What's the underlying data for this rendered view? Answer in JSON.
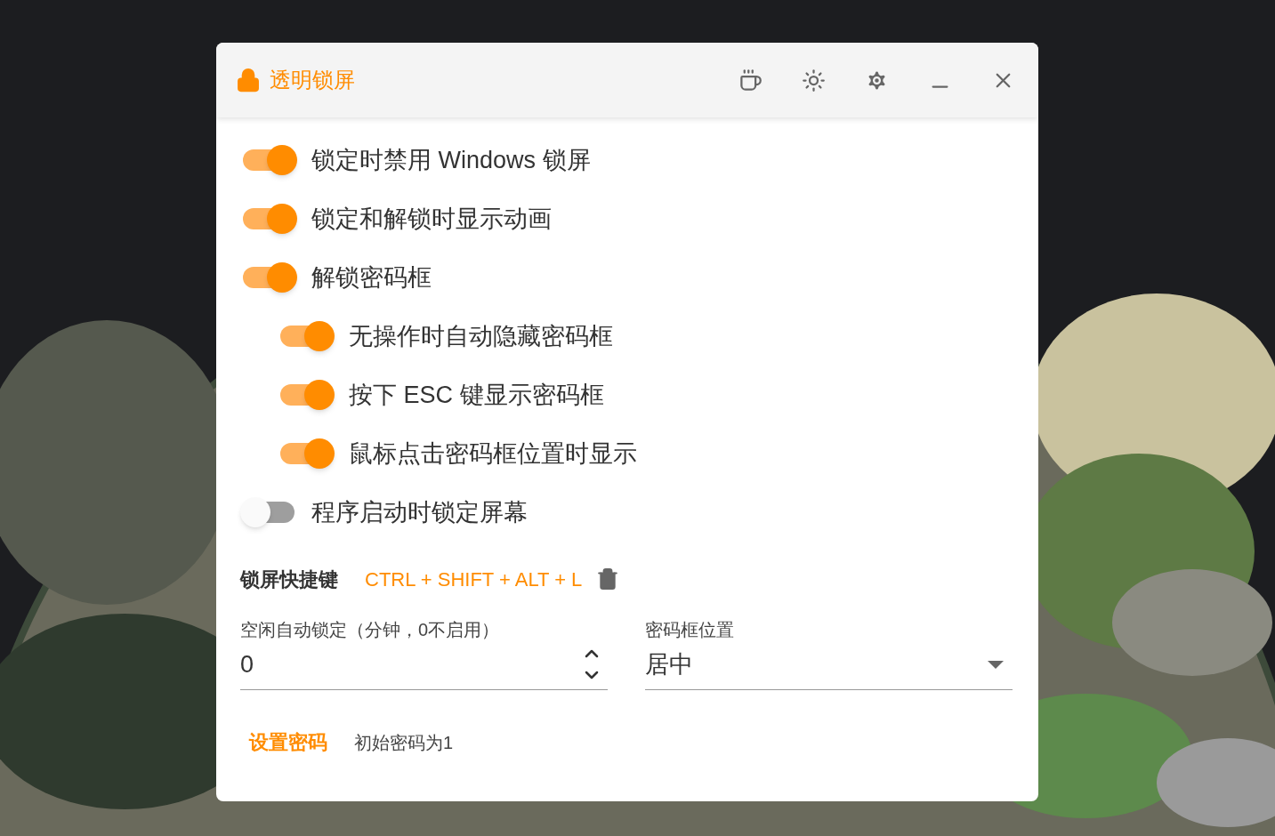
{
  "window": {
    "title": "透明锁屏"
  },
  "options": [
    {
      "label": "锁定时禁用 Windows 锁屏",
      "on": true
    },
    {
      "label": "锁定和解锁时显示动画",
      "on": true
    },
    {
      "label": "解锁密码框",
      "on": true,
      "children": [
        {
          "label": "无操作时自动隐藏密码框",
          "on": true
        },
        {
          "label": "按下 ESC 键显示密码框",
          "on": true
        },
        {
          "label": "鼠标点击密码框位置时显示",
          "on": true
        }
      ]
    },
    {
      "label": "程序启动时锁定屏幕",
      "on": false
    }
  ],
  "hotkey": {
    "label": "锁屏快捷键",
    "value": "CTRL + SHIFT + ALT + L"
  },
  "idle_lock": {
    "label": "空闲自动锁定（分钟，0不启用）",
    "value": "0"
  },
  "password_position": {
    "label": "密码框位置",
    "value": "居中"
  },
  "set_password": {
    "button": "设置密码",
    "hint": "初始密码为1"
  }
}
